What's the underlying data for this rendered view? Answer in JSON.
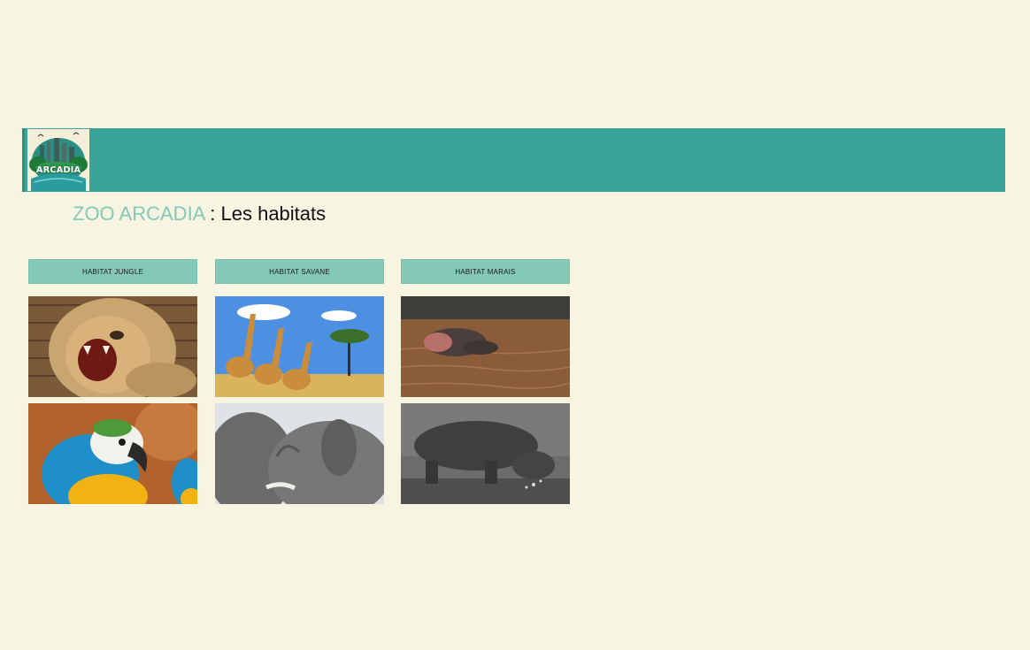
{
  "header": {
    "logo_text": "ARCADIA",
    "logo_icon": "zoo-arcadia-logo-icon",
    "bar_color": "#3aa499"
  },
  "heading": {
    "brand": "ZOO ARCADIA",
    "separator": " : ",
    "title": "Les habitats",
    "brand_color": "#84c9b6"
  },
  "habitats": [
    {
      "label": "HABITAT JUNGLE",
      "images": [
        "lion-photo",
        "macaw-parrot-photo"
      ]
    },
    {
      "label": "HABITAT SAVANE",
      "images": [
        "giraffes-photo",
        "elephants-photo"
      ]
    },
    {
      "label": "HABITAT MARAIS",
      "images": [
        "hippo-in-water-photo",
        "hippo-walking-photo"
      ]
    }
  ],
  "colors": {
    "background": "#f7f4e2",
    "button": "#84c9b6"
  }
}
